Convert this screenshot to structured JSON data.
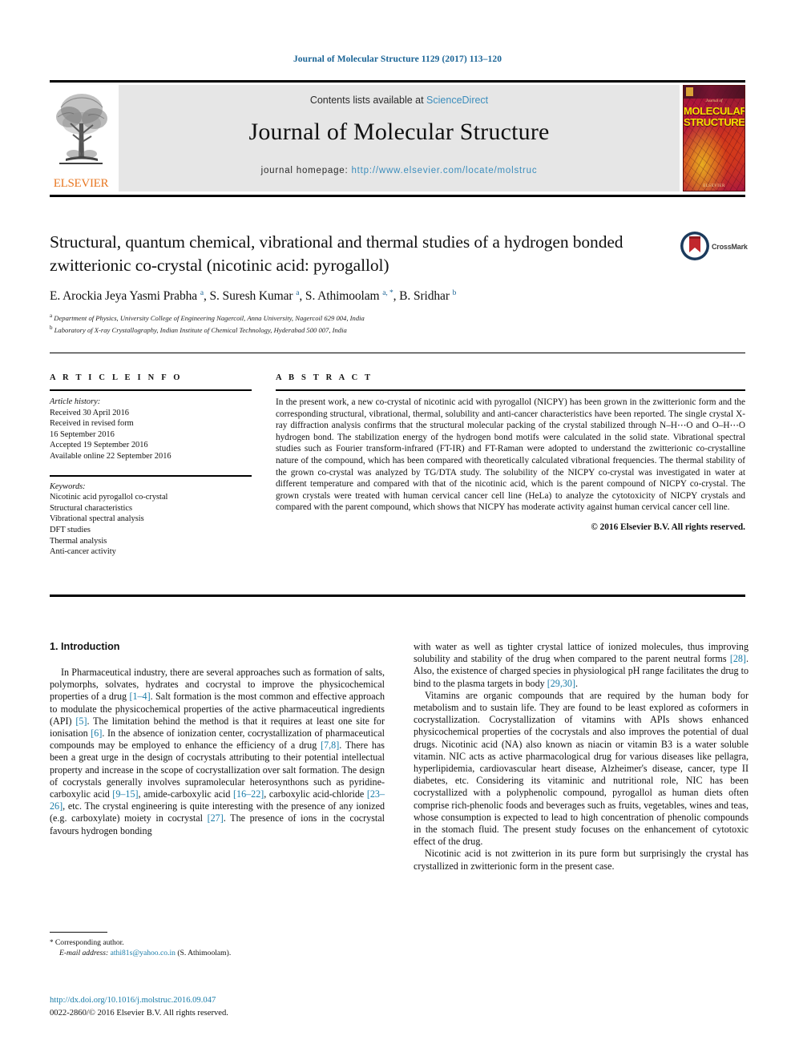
{
  "running_head": "Journal of Molecular Structure 1129 (2017) 113–120",
  "masthead": {
    "contents_prefix": "Contents lists available at ",
    "sciencedirect": "ScienceDirect",
    "journal_title": "Journal of Molecular Structure",
    "homepage_prefix": "journal homepage: ",
    "homepage_url": "http://www.elsevier.com/locate/molstruc",
    "publisher": "ELSEVIER",
    "cover": {
      "journal_word": "Journal of",
      "line1": "MOLECULAR",
      "line2": "STRUCTURE",
      "publisher_small": "ELSEVIER"
    },
    "colors": {
      "link": "#3c8dbc",
      "banner_bg": "#e6e6e6",
      "elsevier_orange": "#e87722",
      "cover_title_yellow": "#f6e000"
    }
  },
  "article": {
    "title": "Structural, quantum chemical, vibrational and thermal studies of a hydrogen bonded zwitterionic co-crystal (nicotinic acid: pyrogallol)",
    "authors_html": "E. Arockia Jeya Yasmi Prabha <sup>a</sup>, S. Suresh Kumar <sup>a</sup>, S. Athimoolam <sup>a, *</sup>, B. Sridhar <sup>b</sup>",
    "affiliations": [
      "a Department of Physics, University College of Engineering Nagercoil, Anna University, Nagercoil 629 004, India",
      "b Laboratory of X-ray Crystallography, Indian Institute of Chemical Technology, Hyderabad 500 007, India"
    ],
    "crossmark_label": "CrossMark"
  },
  "article_info": {
    "heading": "A R T I C L E   I N F O",
    "history_label": "Article history:",
    "history": [
      "Received 30 April 2016",
      "Received in revised form",
      "16 September 2016",
      "Accepted 19 September 2016",
      "Available online 22 September 2016"
    ],
    "keywords_label": "Keywords:",
    "keywords": [
      "Nicotinic acid pyrogallol co-crystal",
      "Structural characteristics",
      "Vibrational spectral analysis",
      "DFT studies",
      "Thermal analysis",
      "Anti-cancer activity"
    ]
  },
  "abstract": {
    "heading": "A B S T R A C T",
    "text": "In the present work, a new co-crystal of nicotinic acid with pyrogallol (NICPY) has been grown in the zwitterionic form and the corresponding structural, vibrational, thermal, solubility and anti-cancer characteristics have been reported. The single crystal X-ray diffraction analysis confirms that the structural molecular packing of the crystal stabilized through N–H⋯O and O–H⋯O hydrogen bond. The stabilization energy of the hydrogen bond motifs were calculated in the solid state. Vibrational spectral studies such as Fourier transform-infrared (FT-IR) and FT-Raman were adopted to understand the zwitterionic co-crystalline nature of the compound, which has been compared with theoretically calculated vibrational frequencies. The thermal stability of the grown co-crystal was analyzed by TG/DTA study. The solubility of the NICPY co-crystal was investigated in water at different temperature and compared with that of the nicotinic acid, which is the parent compound of NICPY co-crystal. The grown crystals were treated with human cervical cancer cell line (HeLa) to analyze the cytotoxicity of NICPY crystals and compared with the parent compound, which shows that NICPY has moderate activity against human cervical cancer cell line.",
    "copyright": "© 2016 Elsevier B.V. All rights reserved."
  },
  "introduction": {
    "heading": "1.  Introduction",
    "left_paragraphs": [
      "In Pharmaceutical industry, there are several approaches such as formation of salts, polymorphs, solvates, hydrates and cocrystal to improve the physicochemical properties of a drug <c>[1–4]</c>. Salt formation is the most common and effective approach to modulate the physicochemical properties of the active pharmaceutical ingredients (API) <c>[5]</c>. The limitation behind the method is that it requires at least one site for ionisation <c>[6]</c>. In the absence of ionization center, cocrystallization of pharmaceutical compounds may be employed to enhance the efficiency of a drug <c>[7,8]</c>. There has been a great urge in the design of cocrystals attributing to their potential intellectual property and increase in the scope of cocrystallization over salt formation. The design of cocrystals generally involves supramolecular heterosynthons such as pyridine-carboxylic acid <c>[9–15]</c>, amide-carboxylic acid <c>[16–22]</c>, carboxylic acid-chloride <c>[23–26]</c>, etc. The crystal engineering is quite interesting with the presence of any ionized (e.g. carboxylate) moiety in cocrystal <c>[27]</c>. The presence of ions in the cocrystal favours hydrogen bonding"
    ],
    "right_paragraphs": [
      "with water as well as tighter crystal lattice of ionized molecules, thus improving solubility and stability of the drug when compared to the parent neutral forms <c>[28]</c>. Also, the existence of charged species in physiological pH range facilitates the drug to bind to the plasma targets in body <c>[29,30]</c>.",
      "Vitamins are organic compounds that are required by the human body for metabolism and to sustain life. They are found to be least explored as coformers in cocrystallization. Cocrystallization of vitamins with APIs shows enhanced physicochemical properties of the cocrystals and also improves the potential of dual drugs. Nicotinic acid (NA) also known as niacin or vitamin B3 is a water soluble vitamin. NIC acts as active pharmacological drug for various diseases like pellagra, hyperlipidemia, cardiovascular heart disease, Alzheimer's disease, cancer, type II diabetes, etc. Considering its vitaminic and nutritional role, NIC has been cocrystallized with a polyphenolic compound, pyrogallol as human diets often comprise rich-phenolic foods and beverages such as fruits, vegetables, wines and teas, whose consumption is expected to lead to high concentration of phenolic compounds in the stomach fluid. The present study focuses on the enhancement of cytotoxic effect of the drug.",
      "Nicotinic acid is not zwitterion in its pure form but surprisingly the crystal has crystallized in zwitterionic form in the present case."
    ],
    "citation_color": "#1a7ca8"
  },
  "footer": {
    "corresponding_author": "Corresponding author.",
    "email_label": "E-mail address:",
    "email": "athi81s@yahoo.co.in",
    "email_owner": "(S. Athimoolam).",
    "doi": "http://dx.doi.org/10.1016/j.molstruc.2016.09.047",
    "issn": "0022-2860/© 2016 Elsevier B.V. All rights reserved."
  }
}
